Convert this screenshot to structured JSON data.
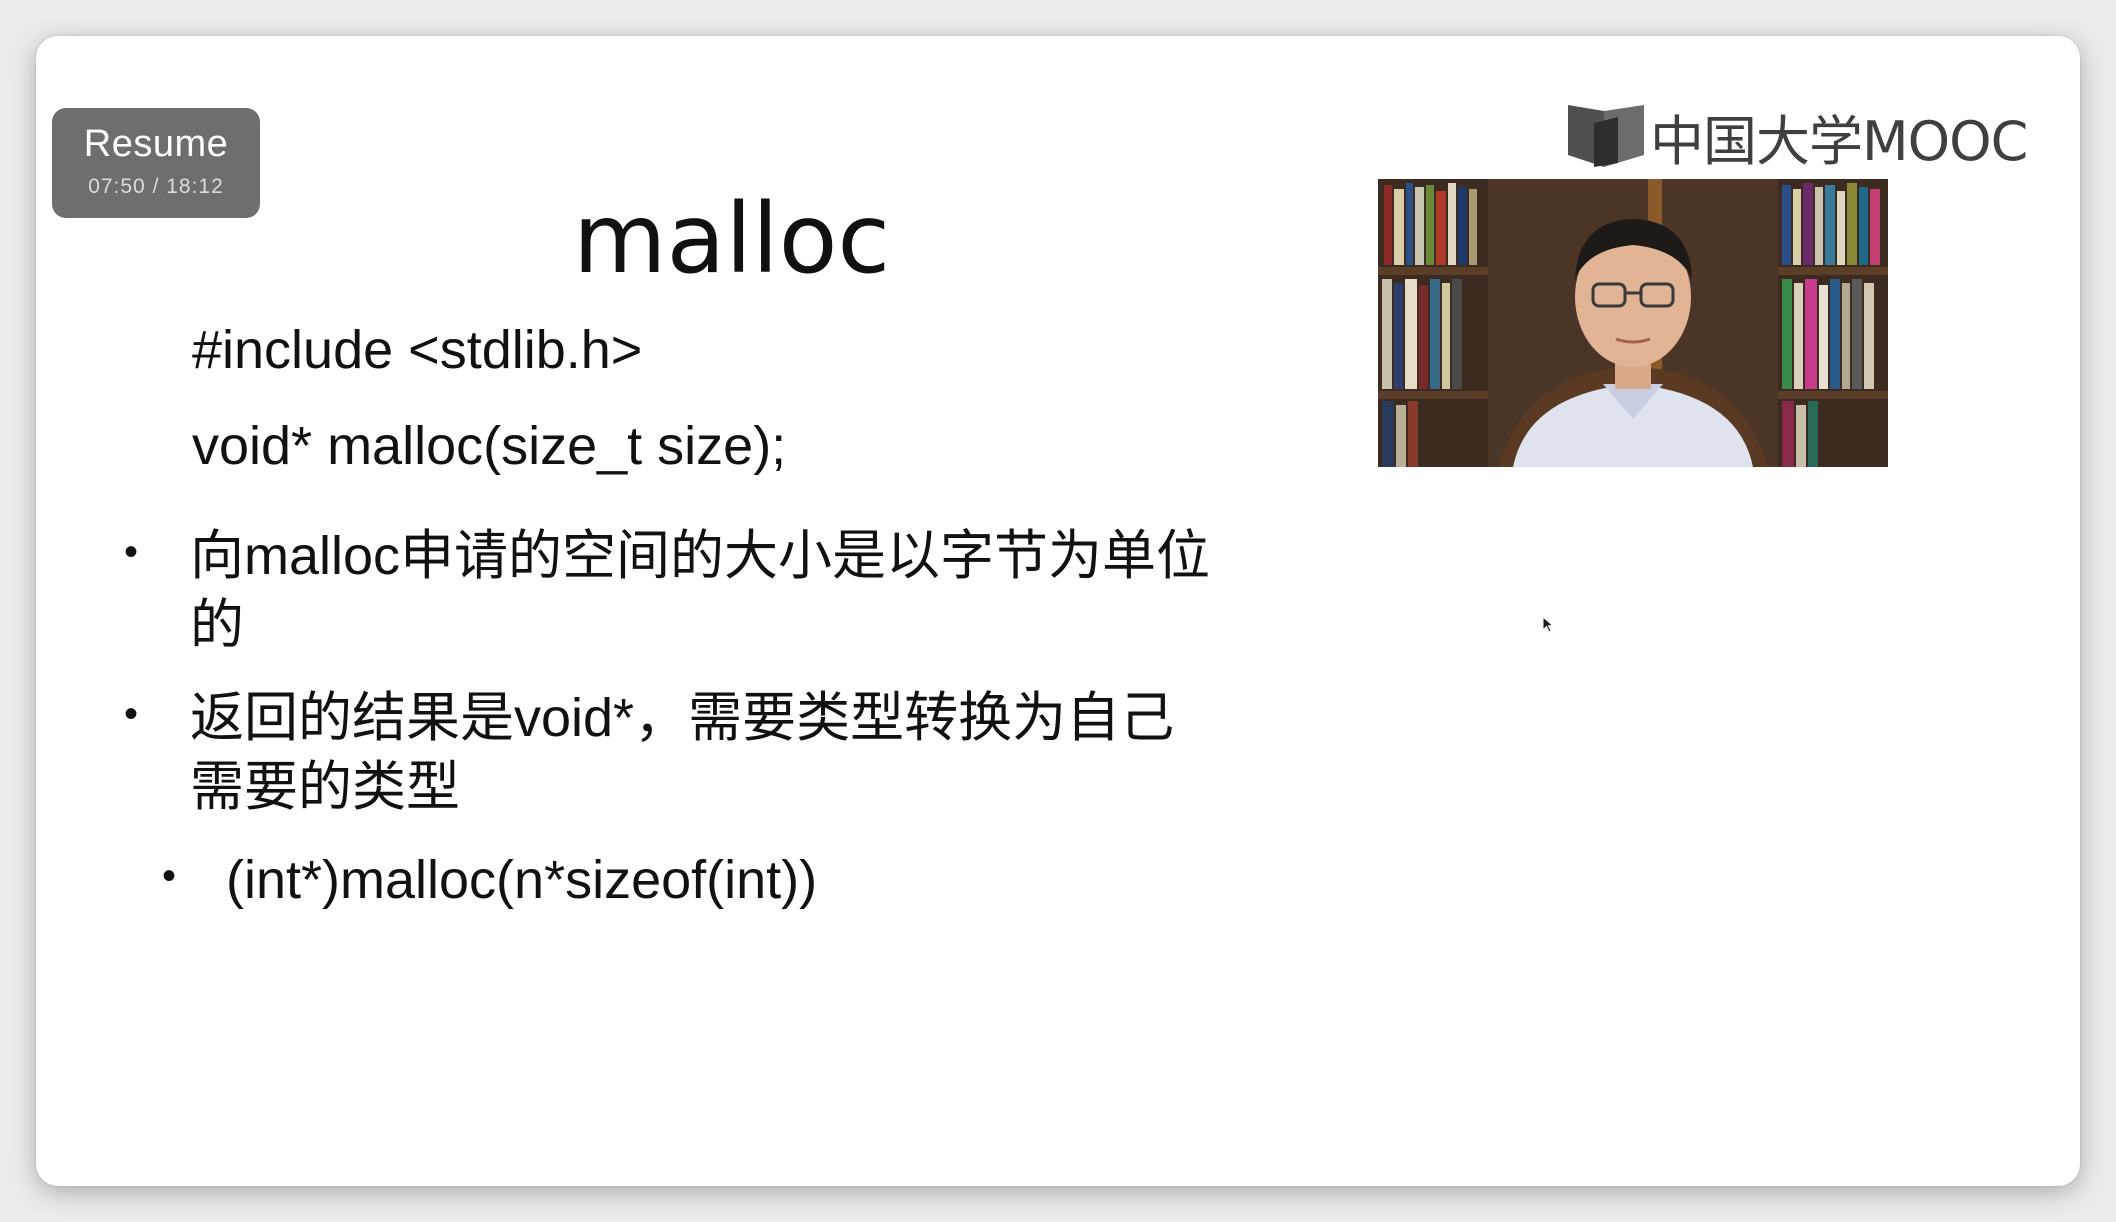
{
  "player": {
    "resume_label": "Resume",
    "time_display": "07:50 / 18:12"
  },
  "slide": {
    "title": "malloc",
    "include_line": "#include <stdlib.h>",
    "signature_line": "void* malloc(size_t size);",
    "bullets": [
      {
        "line1": "向malloc申请的空间的大小是以字节为单位",
        "line2": "的"
      },
      {
        "line1": "返回的结果是void*，需要类型转换为自己",
        "line2": "需要的类型"
      }
    ],
    "sub_bullet": "(int*)malloc(n*sizeof(int))"
  },
  "logo": {
    "text": "中国大学MOOC",
    "icon": "book-icon"
  },
  "video": {
    "icon": "presenter-video-thumbnail"
  }
}
